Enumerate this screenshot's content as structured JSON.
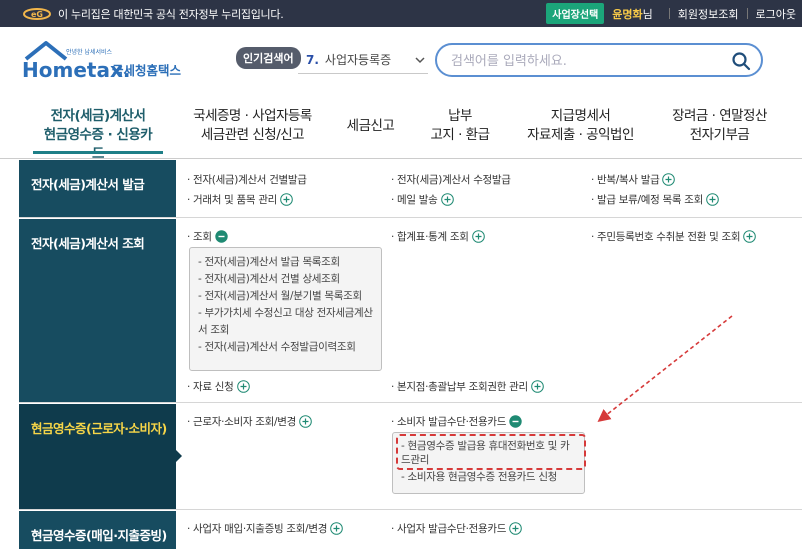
{
  "topbar": {
    "gov_notice": "이 누리집은 대한민국 공식 전자정부 누리집입니다.",
    "biz_select_label": "사업장선택",
    "user_name": "윤명화",
    "user_suffix": "님",
    "member_info_label": "회원정보조회",
    "logout_label": "로그아웃"
  },
  "header": {
    "logo_tagline": "안녕한 납세서비스",
    "logo_brand": "Hometax.",
    "logo_korean": "국세청홈택스",
    "popular_badge": "인기검색어",
    "popular_rank": "7.",
    "popular_value": "사업자등록증",
    "search_placeholder": "검색어를 입력하세요."
  },
  "nav": {
    "items": [
      {
        "line1": "전자(세금)계산서",
        "line2": "현금영수증 · 신용카드"
      },
      {
        "line1": "국세증명 · 사업자등록",
        "line2": "세금관련 신청/신고"
      },
      {
        "line1": "세금신고",
        "line2": ""
      },
      {
        "line1": "납부",
        "line2": "고지 · 환급"
      },
      {
        "line1": "지급명세서",
        "line2": "자료제출 · 공익법인"
      },
      {
        "line1": "장려금 · 연말정산",
        "line2": "전자기부금"
      }
    ]
  },
  "menu": {
    "rows": [
      {
        "title": "전자(세금)계산서 발급",
        "items": [
          "전자(세금)계산서 건별발급",
          "전자(세금)계산서 수정발급",
          "반복/복사 발급",
          "거래처 및 품목 관리",
          "메일 발송",
          "발급 보류/예정 목록 조회"
        ]
      },
      {
        "title": "전자(세금)계산서 조회",
        "items": [
          "조회",
          "합계표·통계 조회",
          "주민등록번호 수취분 전환 및 조회",
          "자료 신청",
          "본지점·총괄납부 조회권한 관리"
        ],
        "sub_items": [
          "전자(세금)계산서 발급 목록조회",
          "전자(세금)계산서 건별 상세조회",
          "전자(세금)계산서 월/분기별 목록조회",
          "부가가치세 수정신고 대상 전자세금계산서 조회",
          "전자(세금)계산서 수정발급이력조회"
        ]
      },
      {
        "title": "현금영수증(근로자·소비자)",
        "items": [
          "근로자·소비자 조회/변경",
          "소비자 발급수단·전용카드"
        ],
        "sub_items": [
          "현금영수증 발급용 휴대전화번호 및 카드관리",
          "소비자용 현금영수증 전용카드 신청"
        ]
      },
      {
        "title": "현금영수증(매입·지출증빙)",
        "items": [
          "사업자 매입·지출증빙 조회/변경",
          "사업자 발급수단·전용카드"
        ]
      }
    ]
  },
  "colors": {
    "topbar": "#2d3446",
    "row_head": "#174c60",
    "active_nav": "#1f5e6b",
    "highlight": "#d63a3a",
    "accent_yellow": "#f6d548"
  }
}
